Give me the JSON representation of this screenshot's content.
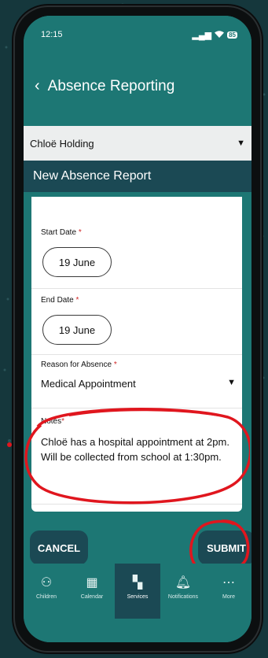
{
  "status": {
    "time": "12:15",
    "signal": "▂▄▆",
    "wifi": "WiFi",
    "battery": "85"
  },
  "header": {
    "back_glyph": "‹",
    "title": "Absence Reporting"
  },
  "child": {
    "selected": "Chloë Holding",
    "caret": "▼"
  },
  "report": {
    "title": "New Absence Report"
  },
  "form": {
    "start_label": "Start Date",
    "start_value": "19 June",
    "end_label": "End Date",
    "end_value": "19 June",
    "reason_label": "Reason for Absence",
    "reason_value": "Medical Appointment",
    "notes_label": "Notes",
    "notes_line1": "Chloë has a hospital appointment at 2pm.",
    "notes_line2": "Will be collected from school at 1:30pm.",
    "required_mark": "*"
  },
  "buttons": {
    "cancel": "CANCEL",
    "submit": "SUBMIT"
  },
  "tabs": [
    {
      "label": "Children",
      "icon": "people-icon",
      "glyph": "⚇"
    },
    {
      "label": "Calendar",
      "icon": "calendar-icon",
      "glyph": "▦"
    },
    {
      "label": "Services",
      "icon": "services-icon",
      "glyph": "▚"
    },
    {
      "label": "Notifications",
      "icon": "bell-icon",
      "glyph": "🔔︎"
    },
    {
      "label": "More",
      "icon": "more-icon",
      "glyph": "⋯"
    }
  ],
  "colors": {
    "teal": "#1d7774",
    "navy": "#1b4954",
    "annotation_red": "#e0161e",
    "background": "#15373c"
  }
}
